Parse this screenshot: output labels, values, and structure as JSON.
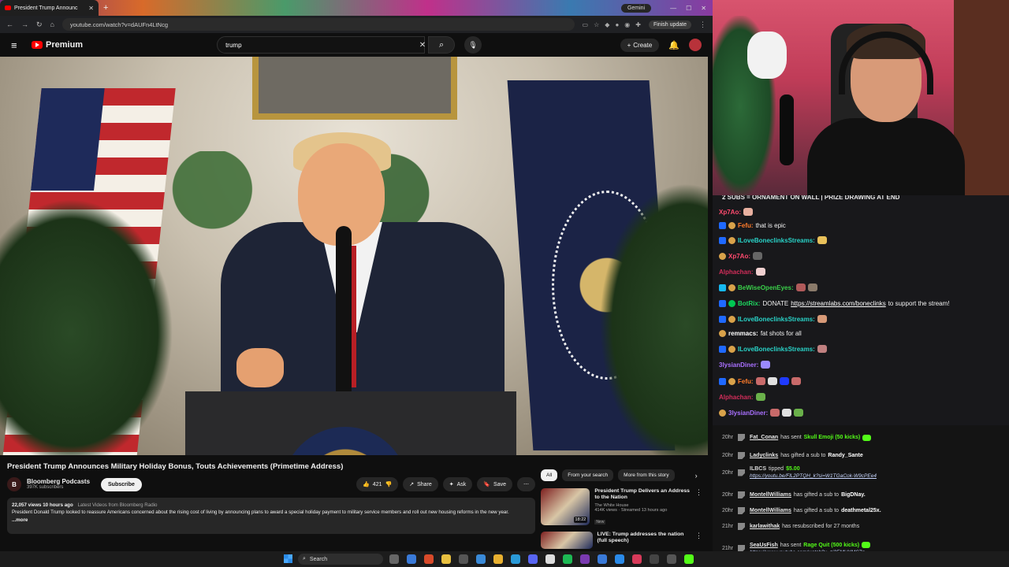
{
  "browser": {
    "tab_title": "President Trump Announc",
    "gemini_label": "Gemini",
    "url": "youtube.com/watch?v=dAUFn4LtNcg",
    "finish_update": "Finish update"
  },
  "youtube": {
    "logo_text": "Premium",
    "search_value": "trump",
    "create_label": "Create",
    "video_title": "President Trump Announces Military Holiday Bonus, Touts Achievements (Primetime Address)",
    "channel_name": "Bloomberg Podcasts",
    "channel_initial": "B",
    "subscribers": "397K subscribers",
    "subscribe_label": "Subscribe",
    "likes": "421",
    "share_label": "Share",
    "ask_label": "Ask",
    "save_label": "Save",
    "views_time": "22,057 views  10 hours ago",
    "latest_videos": "Latest Videos from Bloomberg Radio",
    "description": "President Donald Trump looked to reassure Americans concerned about the rising cost of living by announcing plans to award a special holiday payment to military service members and roll out new housing reforms in the new year.",
    "more_label": "...more",
    "chips": [
      "All",
      "From your search",
      "More from this story"
    ],
    "recommendations": [
      {
        "title": "President Trump Delivers an Address to the Nation",
        "channel": "The White House",
        "meta": "414K views · Streamed 13 hours ago",
        "badge": "New",
        "duration": "18:22"
      },
      {
        "title": "LIVE: Trump addresses the nation (full speech)",
        "channel": "",
        "meta": "",
        "badge": "",
        "duration": ""
      }
    ]
  },
  "chat": {
    "banner": "2 SUBS = ORNAMENT ON WALL | PRIZE DRAWING AT END",
    "messages": [
      {
        "user": "Xp7Ao:",
        "color": "#ff4a6e",
        "text": "",
        "badges": [],
        "emotes": [
          "#e8b0a0"
        ]
      },
      {
        "user": "Fefu:",
        "color": "#ff7b2a",
        "text": "that is epic",
        "badges": [
          "prime",
          "sub"
        ],
        "emotes": []
      },
      {
        "user": "ILoveBoneclinksStreams:",
        "color": "#29d3c8",
        "text": "",
        "badges": [
          "prime",
          "sub"
        ],
        "emotes": [
          "#e8c05a"
        ]
      },
      {
        "user": "Xp7Ao:",
        "color": "#ff4a6e",
        "text": "",
        "badges": [
          "sub"
        ],
        "emotes": [
          "#666666"
        ]
      },
      {
        "user": "Alphachan:",
        "color": "#d22d5a",
        "text": "",
        "badges": [],
        "emotes": [
          "#f0d0d0"
        ]
      },
      {
        "user": "BeWiseOpenEyes:",
        "color": "#3ad04a",
        "text": "",
        "badges": [
          "cyan",
          "sub"
        ],
        "emotes": [
          "#b05a5a",
          "#8a7a6a"
        ]
      },
      {
        "user": "BotRix:",
        "color": "#1ed760",
        "text": "DONATE",
        "link": "https://streamlabs.com/boneclinks",
        "after": "to support the stream!",
        "badges": [
          "prime",
          "bot"
        ],
        "emotes": []
      },
      {
        "user": "ILoveBoneclinksStreams:",
        "color": "#29d3c8",
        "text": "",
        "badges": [
          "prime",
          "sub"
        ],
        "emotes": [
          "#d89a78"
        ]
      },
      {
        "user": "remmacs:",
        "color": "#ffffff",
        "text": "fat shots for all",
        "badges": [
          "sub"
        ],
        "emotes": []
      },
      {
        "user": "ILoveBoneclinksStreams:",
        "color": "#29d3c8",
        "text": "",
        "badges": [
          "prime",
          "sub"
        ],
        "emotes": [
          "#c08080"
        ]
      },
      {
        "user": "3lysianDiner:",
        "color": "#a970ff",
        "text": "",
        "badges": [],
        "emotes": [
          "#9a8aff"
        ]
      },
      {
        "user": "Fefu:",
        "color": "#ff7b2a",
        "text": "",
        "badges": [
          "prime",
          "sub"
        ],
        "emotes": [
          "#c86a6a",
          "#e0e0e0",
          "#1f3aff",
          "#c86a6a"
        ]
      },
      {
        "user": "Alphachan:",
        "color": "#d22d5a",
        "text": "",
        "badges": [],
        "emotes": [
          "#6ab04a"
        ]
      },
      {
        "user": "3lysianDiner:",
        "color": "#a970ff",
        "text": "",
        "badges": [
          "sub"
        ],
        "emotes": [
          "#c86a6a",
          "#e0e0e0",
          "#6ab04a"
        ]
      }
    ]
  },
  "events": [
    {
      "time": "20hr",
      "name": "Fat_Conan",
      "text": "has sent",
      "highlight": "Skull Emoji (50 kicks)",
      "kick": true
    },
    {
      "time": "20hr",
      "name": "Ladyclinks",
      "text": "has gifted a sub to",
      "target": "Randy_Sante"
    },
    {
      "time": "20hr",
      "name": "ILBCS",
      "text": "tipped",
      "highlight": "$5.00",
      "link": "https://youtu.be/FlL2PTQH_k?si=W1TGaCok-W9cPEe4"
    },
    {
      "time": "20hr",
      "name": "MontellWilliams",
      "text": "has gifted a sub to",
      "target": "BigDNay."
    },
    {
      "time": "20hr",
      "name": "MontellWilliams",
      "text": "has gifted a sub to",
      "target": "deathmetal25x."
    },
    {
      "time": "21hr",
      "name": "karlawithak",
      "text": "has resubscribed for 27 months"
    },
    {
      "time": "21hr",
      "name": "SeaUsFish",
      "text": "has sent",
      "highlight": "Rage Quit (500 kicks)",
      "kick": true,
      "link": "https://www.youtube.com/watch?v=zi3EMUYMS7g"
    }
  ],
  "taskbar": {
    "search_placeholder": "Search"
  }
}
